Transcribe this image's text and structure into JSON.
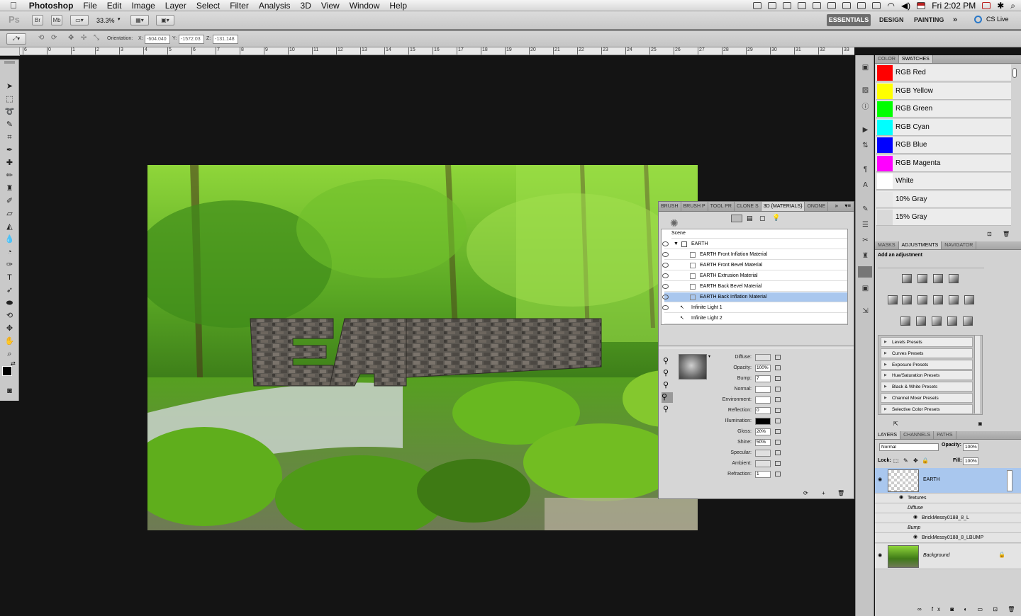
{
  "menubar": {
    "apple": "",
    "app": "Photoshop",
    "items": [
      "File",
      "Edit",
      "Image",
      "Layer",
      "Select",
      "Filter",
      "Analysis",
      "3D",
      "View",
      "Window",
      "Help"
    ],
    "clock": "Fri 2:02 PM"
  },
  "appbar": {
    "ps": "Ps",
    "br": "Br",
    "mb": "Mb",
    "zoom": "33.3%",
    "workspaces": {
      "essentials": "ESSENTIALS",
      "design": "DESIGN",
      "painting": "PAINTING",
      "more": "»"
    },
    "cslive": "CS Live"
  },
  "options": {
    "orientation_label": "Orientation:",
    "x_label": "X:",
    "x_value": "-604.040",
    "y_label": "Y:",
    "y_value": "-1572.03",
    "z_label": "Z:",
    "z_value": "-131.148"
  },
  "ruler": [
    "6",
    "0",
    "1",
    "2",
    "3",
    "4",
    "5",
    "6",
    "7",
    "8",
    "9",
    "10",
    "11",
    "12",
    "13",
    "14",
    "15",
    "16",
    "17",
    "18",
    "19",
    "20",
    "21",
    "22",
    "23",
    "24",
    "25",
    "26",
    "27",
    "28",
    "29",
    "30",
    "31",
    "32",
    "33"
  ],
  "panel3d": {
    "tabs": [
      "BRUSH",
      "BRUSH P",
      "TOOL PR",
      "CLONE S",
      "3D {MATERIALS}",
      "ONONE"
    ],
    "scene": "Scene",
    "earth": "EARTH",
    "materials": [
      "EARTH Front Inflation Material",
      "EARTH Front Bevel Material",
      "EARTH Extrusion Material",
      "EARTH Back Bevel Material",
      "EARTH Back Inflation Material"
    ],
    "lights": [
      "Infinite Light 1",
      "Infinite Light 2"
    ],
    "props": [
      {
        "label": "Diffuse:",
        "value": ""
      },
      {
        "label": "Opacity:",
        "value": "100%"
      },
      {
        "label": "Bump:",
        "value": "7"
      },
      {
        "label": "Normal:",
        "value": ""
      },
      {
        "label": "Environment:",
        "value": ""
      },
      {
        "label": "Reflection:",
        "value": "0"
      },
      {
        "label": "Illumination:",
        "value": ""
      },
      {
        "label": "Gloss:",
        "value": "20%"
      },
      {
        "label": "Shine:",
        "value": "50%"
      },
      {
        "label": "Specular:",
        "value": ""
      },
      {
        "label": "Ambient:",
        "value": ""
      },
      {
        "label": "Refraction:",
        "value": "1"
      }
    ]
  },
  "swatches": {
    "tabs": [
      "COLOR",
      "SWATCHES"
    ],
    "items": [
      {
        "name": "RGB Red",
        "color": "#ff0000"
      },
      {
        "name": "RGB Yellow",
        "color": "#ffff00"
      },
      {
        "name": "RGB Green",
        "color": "#00ff00"
      },
      {
        "name": "RGB Cyan",
        "color": "#00ffff"
      },
      {
        "name": "RGB Blue",
        "color": "#0000ff"
      },
      {
        "name": "RGB Magenta",
        "color": "#ff00ff"
      },
      {
        "name": "White",
        "color": "#ffffff"
      },
      {
        "name": "10% Gray",
        "color": "#e6e6e6"
      },
      {
        "name": "15% Gray",
        "color": "#d9d9d9"
      }
    ]
  },
  "adjustments": {
    "tabs": [
      "MASKS",
      "ADJUSTMENTS",
      "NAVIGATOR"
    ],
    "heading": "Add an adjustment",
    "presets": [
      "Levels Presets",
      "Curves Presets",
      "Exposure Presets",
      "Hue/Saturation Presets",
      "Black & White Presets",
      "Channel Mixer Presets",
      "Selective Color Presets"
    ]
  },
  "layers": {
    "tabs": [
      "LAYERS",
      "CHANNELS",
      "PATHS"
    ],
    "blend": "Normal",
    "opacity_label": "Opacity:",
    "opacity": "100%",
    "lock_label": "Lock:",
    "fill_label": "Fill:",
    "fill": "100%",
    "items": {
      "earth": "EARTH",
      "textures": "Textures",
      "diffuse": "Diffuse",
      "diffuse_tex": "BrickMessy0188_8_L",
      "bump": "Bump",
      "bump_tex": "BrickMessy0188_8_LBUMP",
      "background": "Background"
    }
  }
}
